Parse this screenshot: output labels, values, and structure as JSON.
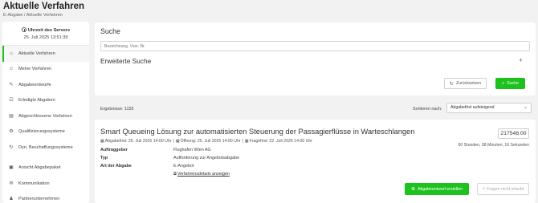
{
  "page": {
    "title": "Aktuelle Verfahren",
    "breadcrumb": "E-Abgabe / Aktuelle Verfahren"
  },
  "sidebar": {
    "server_label": "Uhrzeit des Servers",
    "server_time": "25. Juli 2025 13:51:39",
    "items": [
      {
        "label": "Aktuelle Verfahren",
        "icon": "home-icon",
        "active": true
      },
      {
        "label": "Meine Verfahren",
        "icon": "user-circle-icon"
      },
      {
        "label": "Abgabeentwürfe",
        "icon": "edit-icon"
      },
      {
        "label": "Erledigte Abgaben",
        "icon": "check-square-icon"
      },
      {
        "label": "Abgeschlossene Verfahren",
        "icon": "archive-icon"
      },
      {
        "label": "Qualifizierungssysteme",
        "icon": "settings-icon"
      },
      {
        "label": "Dyn. Beschaffungssysteme",
        "icon": "cycle-icon"
      },
      {
        "label": "Ansicht Abgabepaket",
        "icon": "package-icon"
      },
      {
        "label": "Kommunikation",
        "icon": "chat-icon"
      },
      {
        "label": "Partnerunternehmen",
        "icon": "users-icon"
      }
    ]
  },
  "search": {
    "title": "Suche",
    "placeholder": "Bezeichnung, Vsnr. Nr.",
    "advanced_title": "Erweiterte Suche",
    "reset_label": "Zurücksetzen",
    "search_label": "Suche"
  },
  "results": {
    "count_label": "Ergebnisse: 1155",
    "sort_label": "Sortieren nach:",
    "sort_value": "Abgabefrist aufsteigend"
  },
  "procedure": {
    "title": "Smart Queueing Lösung zur automatisierten Steuerung der Passagierflüsse in Warteschlangen",
    "id": "217548.00",
    "deadline": "Abgabefrist: 25. Juli 2025 14:00 Uhr",
    "opening": "Öffnung: 25. Juli 2025 14:00 Uhr",
    "question_deadline": "Fragefrist: 22. Juli 2025 14:00 Uhr",
    "remaining": "00 Stunden, 08 Minuten, 16 Sekunden",
    "details": [
      {
        "key": "Auftraggeber",
        "value": "Flughafen Wien AG"
      },
      {
        "key": "Typ",
        "value": "Aufforderung zur Angebotsabgabe"
      },
      {
        "key": "Art der Abgabe",
        "value": "E-Angebot"
      }
    ],
    "details_link": "Verfahrensdetails anzeigen",
    "create_label": "Abgabeentwurf erstellen",
    "questions_label": "Fragen nicht erlaubt"
  },
  "colors": {
    "accent": "#1ec21e",
    "background": "#f2f2f2"
  }
}
